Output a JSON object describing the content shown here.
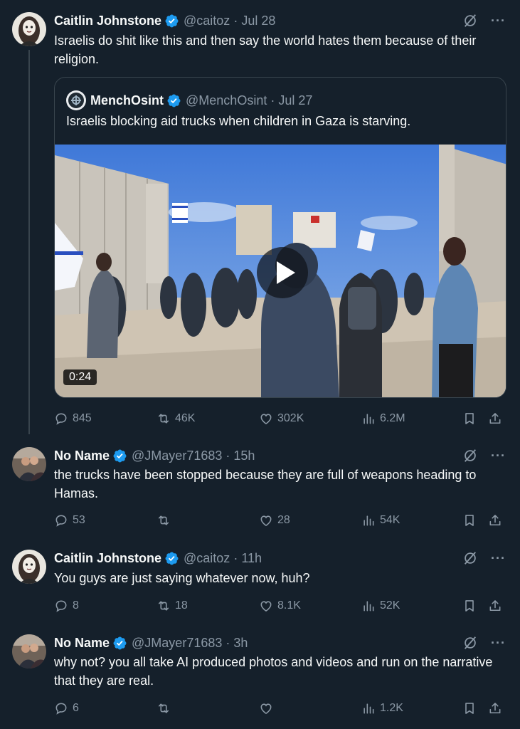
{
  "tweets": [
    {
      "name": "Caitlin Johnstone",
      "handle": "@caitoz",
      "time": "Jul 28",
      "text": "Israelis do shit like this and then say the world hates them because of their religion.",
      "quote": {
        "name": "MenchOsint",
        "handle": "@MenchOsint",
        "time": "Jul 27",
        "text": "Israelis blocking aid trucks when children in Gaza is starving.",
        "video_duration": "0:24"
      },
      "stats": {
        "replies": "845",
        "reposts": "46K",
        "likes": "302K",
        "views": "6.2M"
      }
    },
    {
      "name": "No Name",
      "handle": "@JMayer71683",
      "time": "15h",
      "text": "the trucks have been stopped because they are full of weapons heading to Hamas.",
      "stats": {
        "replies": "53",
        "reposts": "",
        "likes": "28",
        "views": "54K"
      }
    },
    {
      "name": "Caitlin Johnstone",
      "handle": "@caitoz",
      "time": "11h",
      "text": "You guys are just saying whatever now, huh?",
      "stats": {
        "replies": "8",
        "reposts": "18",
        "likes": "8.1K",
        "views": "52K"
      }
    },
    {
      "name": "No Name",
      "handle": "@JMayer71683",
      "time": "3h",
      "text": "why not? you all take AI produced photos and videos and run on the narrative that they are real.",
      "stats": {
        "replies": "6",
        "reposts": "",
        "likes": "",
        "views": "1.2K"
      }
    }
  ],
  "separator": "·",
  "more_glyph": "···",
  "colors": {
    "background": "#15202b",
    "verified": "#1d9bf0",
    "muted": "#8b98a5",
    "text": "#f7f9f9",
    "border": "#38444d"
  },
  "icons": [
    "verified-badge-icon",
    "grok-icon",
    "more-icon",
    "reply-icon",
    "repost-icon",
    "like-icon",
    "views-icon",
    "bookmark-icon",
    "share-icon",
    "play-icon"
  ]
}
